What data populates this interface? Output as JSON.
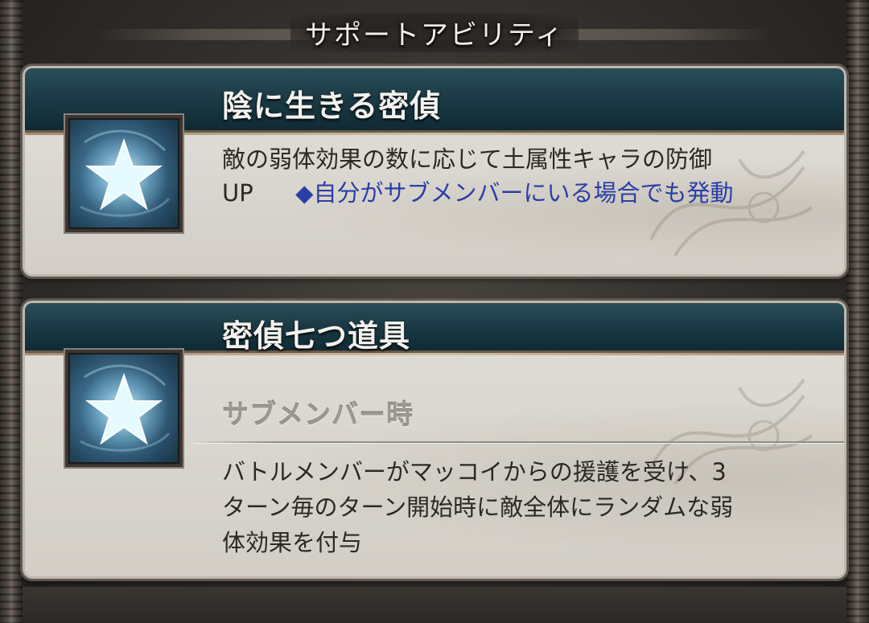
{
  "header": {
    "title": "サポートアビリティ"
  },
  "abilities": [
    {
      "name": "陰に生きる密偵",
      "icon": "star-icon",
      "description_line1": "敵の弱体効果の数に応じて土属性キャラの防御",
      "description_line2_prefix": "UP",
      "description_line2_note": "◆自分がサブメンバーにいる場合でも発動"
    },
    {
      "name": "密偵七つ道具",
      "icon": "star-icon",
      "condition": "サブメンバー時",
      "description_line1": "バトルメンバーがマッコイからの援護を受け、3",
      "description_line2": "ターン毎のターン開始時に敵全体にランダムな弱",
      "description_line3": "体効果を付与"
    }
  ],
  "colors": {
    "note_blue": "#2a3fa6",
    "header_teal": "#1c3b46",
    "body_parchment": "#d9d6cf"
  }
}
